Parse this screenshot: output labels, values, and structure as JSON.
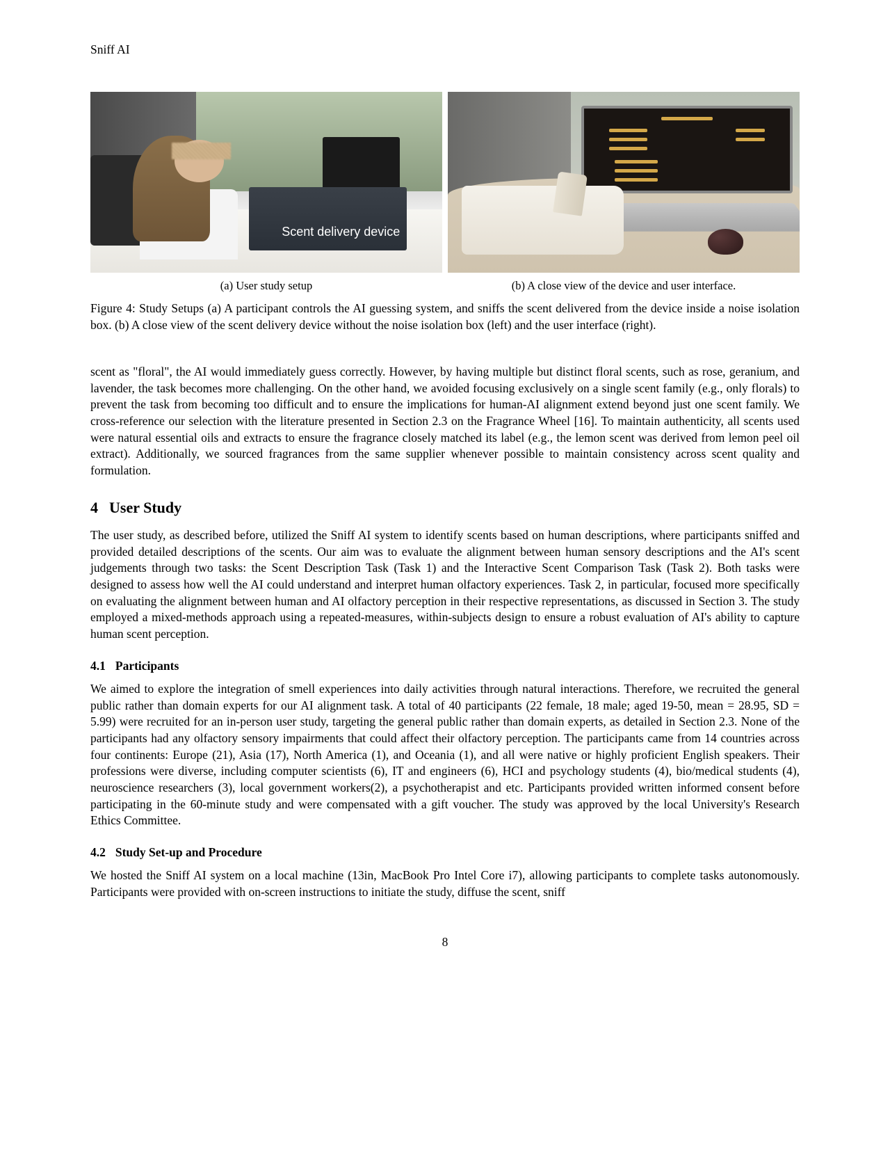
{
  "header": {
    "running_title": "Sniff AI"
  },
  "figure4": {
    "panelA": {
      "overlay_label": "Scent delivery device",
      "subcaption": "(a) User study setup"
    },
    "panelB": {
      "subcaption": "(b) A close view of the device and user interface."
    },
    "caption": "Figure 4: Study Setups (a) A participant controls the AI guessing system, and sniffs the scent delivered from the device inside a noise isolation box. (b) A close view of the scent delivery device without the noise isolation box (left) and the user interface (right)."
  },
  "body": {
    "continuation_para": "scent as \"floral\", the AI would immediately guess correctly. However, by having multiple but distinct floral scents, such as rose, geranium, and lavender, the task becomes more challenging. On the other hand, we avoided focusing exclusively on a single scent family (e.g., only florals) to prevent the task from becoming too difficult and to ensure the implications for human-AI alignment extend beyond just one scent family. We cross-reference our selection with the literature presented in Section 2.3 on the Fragrance Wheel [16]. To maintain authenticity, all scents used were natural essential oils and extracts to ensure the fragrance closely matched its label (e.g., the lemon scent was derived from lemon peel oil extract). Additionally, we sourced fragrances from the same supplier whenever possible to maintain consistency across scent quality and formulation."
  },
  "section4": {
    "number": "4",
    "title": "User Study",
    "intro": "The user study, as described before, utilized the Sniff AI system to identify scents based on human descriptions, where participants sniffed and provided detailed descriptions of the scents. Our aim was to evaluate the alignment between human sensory descriptions and the AI's scent judgements through two tasks: the Scent Description Task (Task 1) and the Interactive Scent Comparison Task (Task 2). Both tasks were designed to assess how well the AI could understand and interpret human olfactory experiences. Task 2, in particular, focused more specifically on evaluating the alignment between human and AI olfactory perception in their respective representations, as discussed in Section 3. The study employed a mixed-methods approach using a repeated-measures, within-subjects design to ensure a robust evaluation of AI's ability to capture human scent perception.",
    "sub41": {
      "number": "4.1",
      "title": "Participants",
      "text": "We aimed to explore the integration of smell experiences into daily activities through natural interactions. Therefore, we recruited the general public rather than domain experts for our AI alignment task. A total of 40 participants (22 female, 18 male; aged 19-50, mean = 28.95, SD = 5.99) were recruited for an in-person user study, targeting the general public rather than domain experts, as detailed in Section 2.3. None of the participants had any olfactory sensory impairments that could affect their olfactory perception. The participants came from 14 countries across four continents: Europe (21), Asia (17), North America (1), and Oceania (1), and all were native or highly proficient English speakers. Their professions were diverse, including computer scientists (6), IT and engineers (6), HCI and psychology students (4), bio/medical students (4), neuroscience researchers (3), local government workers(2), a psychotherapist and etc. Participants provided written informed consent before participating in the 60-minute study and were compensated with a gift voucher. The study was approved by the local University's Research Ethics Committee."
    },
    "sub42": {
      "number": "4.2",
      "title": "Study Set-up and Procedure",
      "text": "We hosted the Sniff AI system on a local machine (13in, MacBook Pro Intel Core i7), allowing participants to complete tasks autonomously. Participants were provided with on-screen instructions to initiate the study, diffuse the scent, sniff"
    }
  },
  "page_number": "8"
}
